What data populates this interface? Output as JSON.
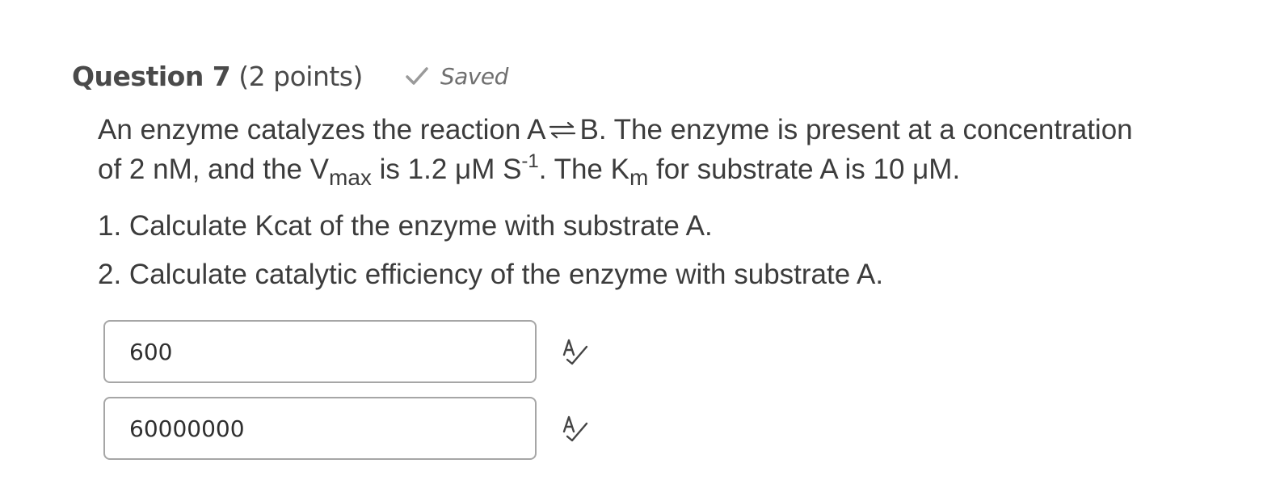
{
  "question": {
    "label": "Question 7",
    "points": "(2 points)",
    "status": "Saved"
  },
  "prompt": {
    "line1_pre": "An enzyme catalyzes the reaction A",
    "line1_post": "B. The enzyme is present at a concentration",
    "line2_a": "of 2 nM, and the V",
    "vmax_sub": "max",
    "line2_b": " is 1.2 μM S",
    "unit_sup": "-1",
    "line2_c": ". The K",
    "km_sub": "m",
    "line2_d": " for substrate A is 10 μM."
  },
  "tasks": [
    "1. Calculate Kcat of the enzyme with substrate A.",
    "2. Calculate catalytic efficiency of the enzyme with substrate A."
  ],
  "answers": [
    {
      "value": "600"
    },
    {
      "value": "60000000"
    }
  ],
  "icons": {
    "saved": "checkmark-icon",
    "equilibrium": "equilibrium-arrow-icon",
    "spellcheck": "spellcheck-icon"
  }
}
